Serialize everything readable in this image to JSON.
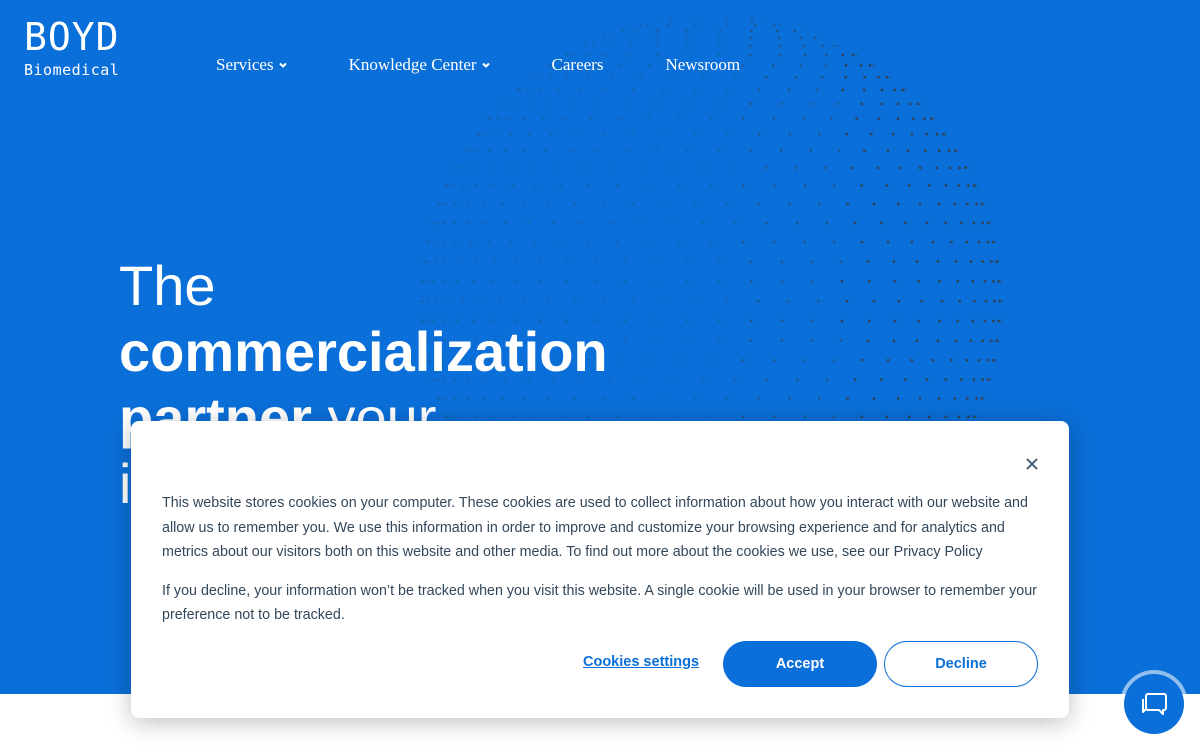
{
  "brand": {
    "name": "BOYD",
    "tagline": "Biomedical"
  },
  "nav": {
    "services": "Services",
    "knowledge_center": "Knowledge Center",
    "careers": "Careers",
    "newsroom": "Newsroom"
  },
  "hero": {
    "line1": "The",
    "line2": "commercialization",
    "line3_bold": "partner",
    "line3_light": " your",
    "line4": "i"
  },
  "cookie_banner": {
    "paragraph1": "This website stores cookies on your computer. These cookies are used to collect information about how you interact with our website and allow us to remember you. We use this information in order to improve and customize your browsing experience and for analytics and metrics about our visitors both on this website and other media. To find out more about the cookies we use, see our Privacy Policy",
    "paragraph2": "If you decline, your information won’t be tracked when you visit this website. A single cookie will be used in your browser to remember your preference not to be tracked.",
    "settings_label": "Cookies settings",
    "accept_label": "Accept",
    "decline_label": "Decline"
  },
  "icons": {
    "close": "close-icon",
    "chat": "chat-icon",
    "chevron": "chevron-down-icon"
  },
  "colors": {
    "brand_blue": "#0a6fd8",
    "text_dark": "#33475b",
    "white": "#ffffff"
  }
}
